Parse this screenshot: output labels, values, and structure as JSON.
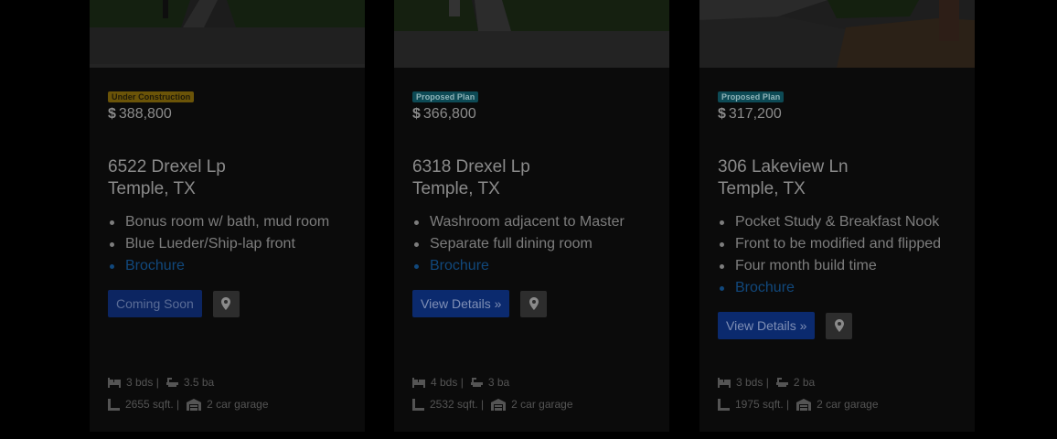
{
  "listings": [
    {
      "status": "Under Construction",
      "status_color": "#6b5408",
      "price_symbol": "$",
      "price": "388,800",
      "street": "6522 Drexel Lp",
      "city": "Temple, TX",
      "features": [
        "Bonus room w/ bath, mud room",
        "Blue Lueder/Ship-lap front"
      ],
      "brochure_label": "Brochure",
      "action_label": "Coming Soon",
      "beds": "3 bds |",
      "baths": "3.5 ba",
      "sqft": "2655 sqft. |",
      "garage": "2 car garage"
    },
    {
      "status": "Proposed Plan",
      "status_color": "#0d4a55",
      "price_symbol": "$",
      "price": "366,800",
      "street": "6318 Drexel Lp",
      "city": "Temple, TX",
      "features": [
        "Washroom adjacent to Master",
        "Separate full dining room"
      ],
      "brochure_label": "Brochure",
      "action_label": "View Details »",
      "beds": "4 bds |",
      "baths": "3 ba",
      "sqft": "2532 sqft. |",
      "garage": "2 car garage"
    },
    {
      "status": "Proposed Plan",
      "status_color": "#0d4a55",
      "price_symbol": "$",
      "price": "317,200",
      "street": "306 Lakeview Ln",
      "city": "Temple, TX",
      "features": [
        "Pocket Study & Breakfast Nook",
        "Front to be modified and flipped",
        "Four month build time"
      ],
      "brochure_label": "Brochure",
      "action_label": "View Details »",
      "beds": "3 bds |",
      "baths": "2 ba",
      "sqft": "1975 sqft. |",
      "garage": "2 car garage"
    }
  ],
  "icons": {
    "map": "map-marker-icon",
    "bed": "bed-icon",
    "bath": "bath-icon",
    "sqft": "ruler-icon",
    "garage": "garage-icon"
  },
  "colors": {
    "overlay_background": "#000000",
    "card_background": "#0b0b0b",
    "button_primary": "#0b2a6e",
    "link": "#11487c"
  }
}
